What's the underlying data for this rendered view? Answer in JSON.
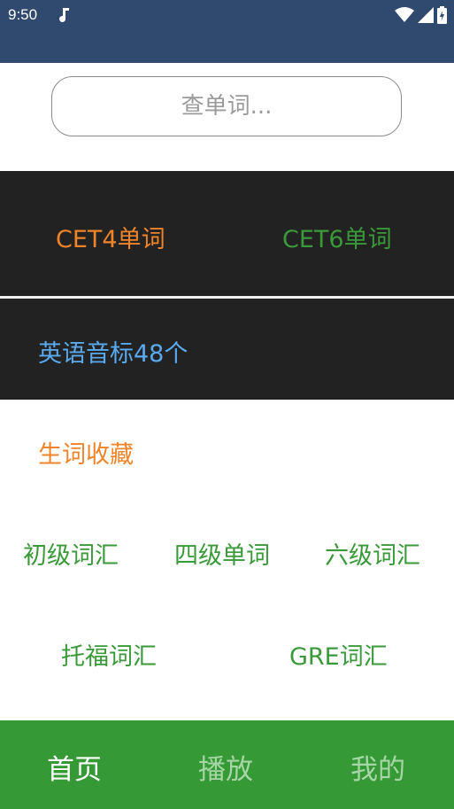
{
  "status_bar": {
    "time": "9:50",
    "background": "#2f4a6e",
    "icons": [
      "music-note-icon",
      "wifi-icon",
      "signal-icon",
      "battery-icon"
    ]
  },
  "search": {
    "placeholder": "查单词..."
  },
  "categories": {
    "cet4": "CET4单词",
    "cet6": "CET6单词",
    "phonetics": "英语音标48个",
    "favorites": "生词收藏",
    "primary": "初级词汇",
    "level4": "四级单词",
    "level6": "六级词汇",
    "toefl": "托福词汇",
    "gre": "GRE词汇"
  },
  "nav": {
    "home": "首页",
    "play": "播放",
    "mine": "我的",
    "active": "home"
  },
  "colors": {
    "orange": "#f0842b",
    "green": "#3a9a3a",
    "blue": "#5aaaf0",
    "dark_panel": "#222222",
    "nav_bg": "#359935"
  }
}
